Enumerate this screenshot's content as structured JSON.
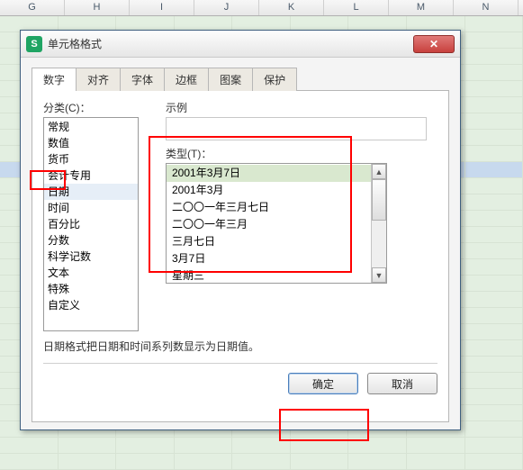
{
  "columns": [
    "G",
    "H",
    "I",
    "J",
    "K",
    "L",
    "M",
    "N"
  ],
  "dialog": {
    "title": "单元格格式",
    "tabs": [
      "数字",
      "对齐",
      "字体",
      "边框",
      "图案",
      "保护"
    ],
    "categoryLabel": "分类(C)：",
    "categories": [
      "常规",
      "数值",
      "货币",
      "会计专用",
      "日期",
      "时间",
      "百分比",
      "分数",
      "科学记数",
      "文本",
      "特殊",
      "自定义"
    ],
    "selectedCategoryIndex": 4,
    "sampleLabel": "示例",
    "typeLabel": "类型(T)：",
    "types": [
      "2001年3月7日",
      "2001年3月",
      "二〇〇一年三月七日",
      "二〇〇一年三月",
      "三月七日",
      "3月7日",
      "星期三"
    ],
    "selectedTypeIndex": 0,
    "description": "日期格式把日期和时间系列数显示为日期值。",
    "okLabel": "确定",
    "cancelLabel": "取消"
  }
}
